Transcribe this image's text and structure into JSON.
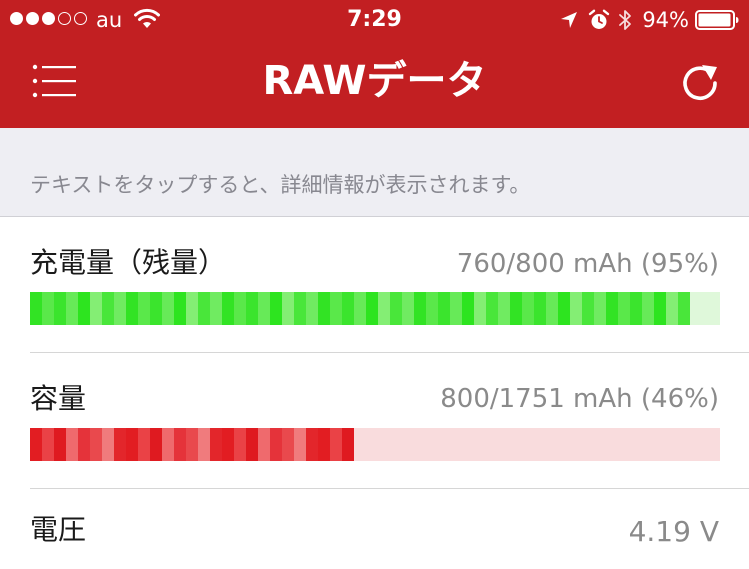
{
  "status_bar": {
    "carrier": "au",
    "time": "7:29",
    "battery_percent": "94%",
    "signal_filled": 3,
    "signal_total": 5
  },
  "nav": {
    "title": "RAWデータ",
    "menu_icon": "list-menu-icon",
    "refresh_icon": "refresh-icon"
  },
  "hint": "テキストをタップすると、詳細情報が表示されます。",
  "rows": [
    {
      "label": "充電量（残量）",
      "value": "760/800 mAh (95%)",
      "fraction": 0.95,
      "colors": [
        "#32e324",
        "#5ae84a",
        "#3be42d",
        "#67ea58",
        "#2de41f",
        "#84ee74",
        "#49e63a",
        "#70eb61"
      ],
      "track_color": "#dff8da"
    },
    {
      "label": "容量",
      "value": "800/1751 mAh (46%)",
      "fraction": 0.46,
      "colors": [
        "#e21d22",
        "#ea4246",
        "#df1a20",
        "#ef6a6d",
        "#e5333a",
        "#e9494d",
        "#f07b7d",
        "#e3262b"
      ],
      "track_color": "#f9dcdd"
    },
    {
      "label": "電圧",
      "value": "4.19 V"
    }
  ],
  "colors": {
    "accent": "#c21f22",
    "hint_bg": "#eeeef3"
  }
}
